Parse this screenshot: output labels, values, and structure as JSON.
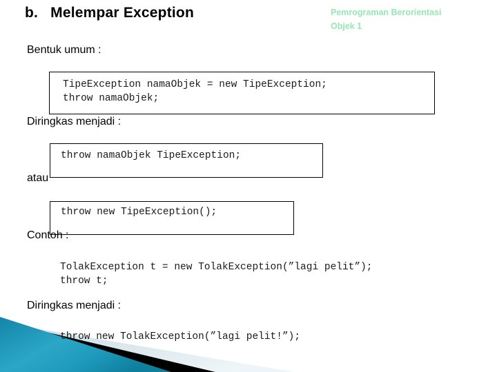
{
  "header": {
    "title": "b.   Melempar Exception",
    "subtitle": "Pemrograman Berorientasi\nObjek 1",
    "subtitle_color": "#97e6b4"
  },
  "labels": {
    "bentuk_umum": "Bentuk umum :",
    "diringkas_menjadi_1": "Diringkas menjadi :",
    "atau": "atau",
    "contoh": "Contoh :",
    "diringkas_menjadi_2": "Diringkas menjadi :"
  },
  "code_blocks": [
    {
      "id": "box-1",
      "boxed": true,
      "text": "TipeException namaObjek = new TipeException;\nthrow namaObjek;"
    },
    {
      "id": "box-2",
      "boxed": true,
      "text": "throw namaObjek TipeException;"
    },
    {
      "id": "box-3",
      "boxed": true,
      "text": "throw new TipeException();"
    },
    {
      "id": "code-example",
      "boxed": false,
      "text": "TolakException t = new TolakException(”lagi pelit”);\nthrow t;"
    },
    {
      "id": "code-final",
      "boxed": false,
      "text": "throw new TolakException(”lagi pelit!”);"
    }
  ],
  "decoration": {
    "name": "bottom-left-corner-graphic",
    "teal_color": "#1f9bbd",
    "teal_dark": "#157c9c",
    "black_color": "#000000",
    "pale_color": "#dde9ef"
  }
}
